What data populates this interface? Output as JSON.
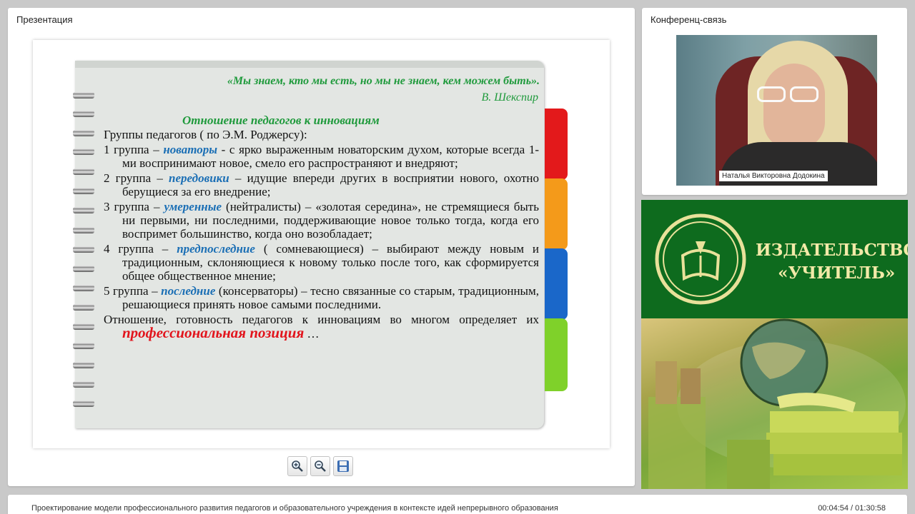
{
  "presentation": {
    "panel_title": "Презентация",
    "slide": {
      "quote": "«Мы знаем, кто мы есть, но мы не знаем, кем можем быть».",
      "quote_author": "В. Шекспир",
      "heading": "Отношение педагогов к инновациям",
      "intro": "Группы педагогов ( по Э.М. Роджерсу):",
      "groups": [
        {
          "lead": "1 группа – ",
          "kw": "новаторы",
          "rest": " - с ярко выраженным новаторским духом, которые всегда 1-ми воспринимают новое, смело его распространяют и внедряют;"
        },
        {
          "lead": "2 группа – ",
          "kw": "передовики",
          "rest": " – идущие впереди других в восприятии нового, охотно берущиеся за его внедрение;"
        },
        {
          "lead": "3 группа – ",
          "kw": "умеренные",
          "rest": " (нейтралисты) – «золотая середина», не стремящиеся быть ни первыми, ни последними, поддерживающие новое только тогда, когда его воспримет большинство, когда оно возобладает;"
        },
        {
          "lead": "4 группа – ",
          "kw": "предпоследние",
          "rest": " ( сомневающиеся) – выбирают между новым и традиционным, склоняющиеся к новому только после того, как сформируется общее общественное мнение;"
        },
        {
          "lead": "5 группа – ",
          "kw": "последние",
          "rest": " (консерваторы) – тесно связанные со старым, традиционным, решающиеся принять новое самыми последними."
        }
      ],
      "conclusion_start": "Отношение, готовность педагогов к инновациям во многом определяет их ",
      "conclusion_emphasis": "профессиональная позиция",
      "conclusion_end": " …"
    },
    "tools": [
      {
        "name": "zoom-in-icon"
      },
      {
        "name": "zoom-out-icon"
      },
      {
        "name": "save-icon"
      }
    ]
  },
  "conference": {
    "panel_title": "Конференц-связь",
    "speaker_name": "Наталья Викторовна Додокина"
  },
  "ad": {
    "title_line1": "ИЗДАТЕЛЬСТВО",
    "title_line2": "«УЧИТЕЛЬ»"
  },
  "footer": {
    "title": "Проектирование модели профессионального развития педагогов и образовательного учреждения в контексте идей непрерывного образования",
    "time": "00:04:54 / 01:30:58"
  },
  "colors": {
    "green": "#1f9a3c",
    "blue": "#1b6fb5",
    "red": "#e2141c",
    "tabs": [
      "#e3191b",
      "#f49a1a",
      "#1a67c9",
      "#7fd12a"
    ]
  }
}
